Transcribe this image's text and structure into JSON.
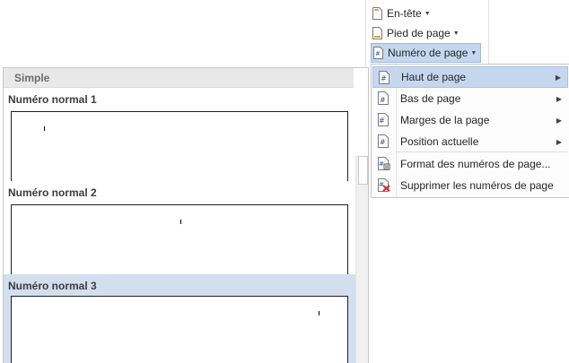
{
  "ribbon": {
    "header_label": "En-tête",
    "footer_label": "Pied de page",
    "page_number_label": "Numéro de page"
  },
  "gallery": {
    "section_label": "Simple",
    "items": [
      {
        "title": "Numéro normal 1",
        "selected": false
      },
      {
        "title": "Numéro normal 2",
        "selected": false
      },
      {
        "title": "Numéro normal 3",
        "selected": true
      }
    ]
  },
  "menu": {
    "items": [
      {
        "label": "Haut de page",
        "has_submenu": true,
        "highlighted": true
      },
      {
        "label": "Bas de page",
        "has_submenu": true,
        "highlighted": false
      },
      {
        "label": "Marges de la page",
        "has_submenu": true,
        "highlighted": false
      },
      {
        "label": "Position actuelle",
        "has_submenu": true,
        "highlighted": false
      },
      {
        "label": "Format des numéros de page...",
        "has_submenu": false,
        "highlighted": false
      },
      {
        "label": "Supprimer les numéros de page",
        "has_submenu": false,
        "highlighted": false
      }
    ]
  },
  "colors": {
    "highlight": "#c5d7ee",
    "selected_item": "#d3dfee",
    "delete_icon": "#d9232b"
  },
  "icons": [
    "header-icon",
    "footer-icon",
    "page-number-icon",
    "page-hash-icon",
    "format-numbers-icon",
    "remove-numbers-icon",
    "submenu-arrow-icon"
  ]
}
